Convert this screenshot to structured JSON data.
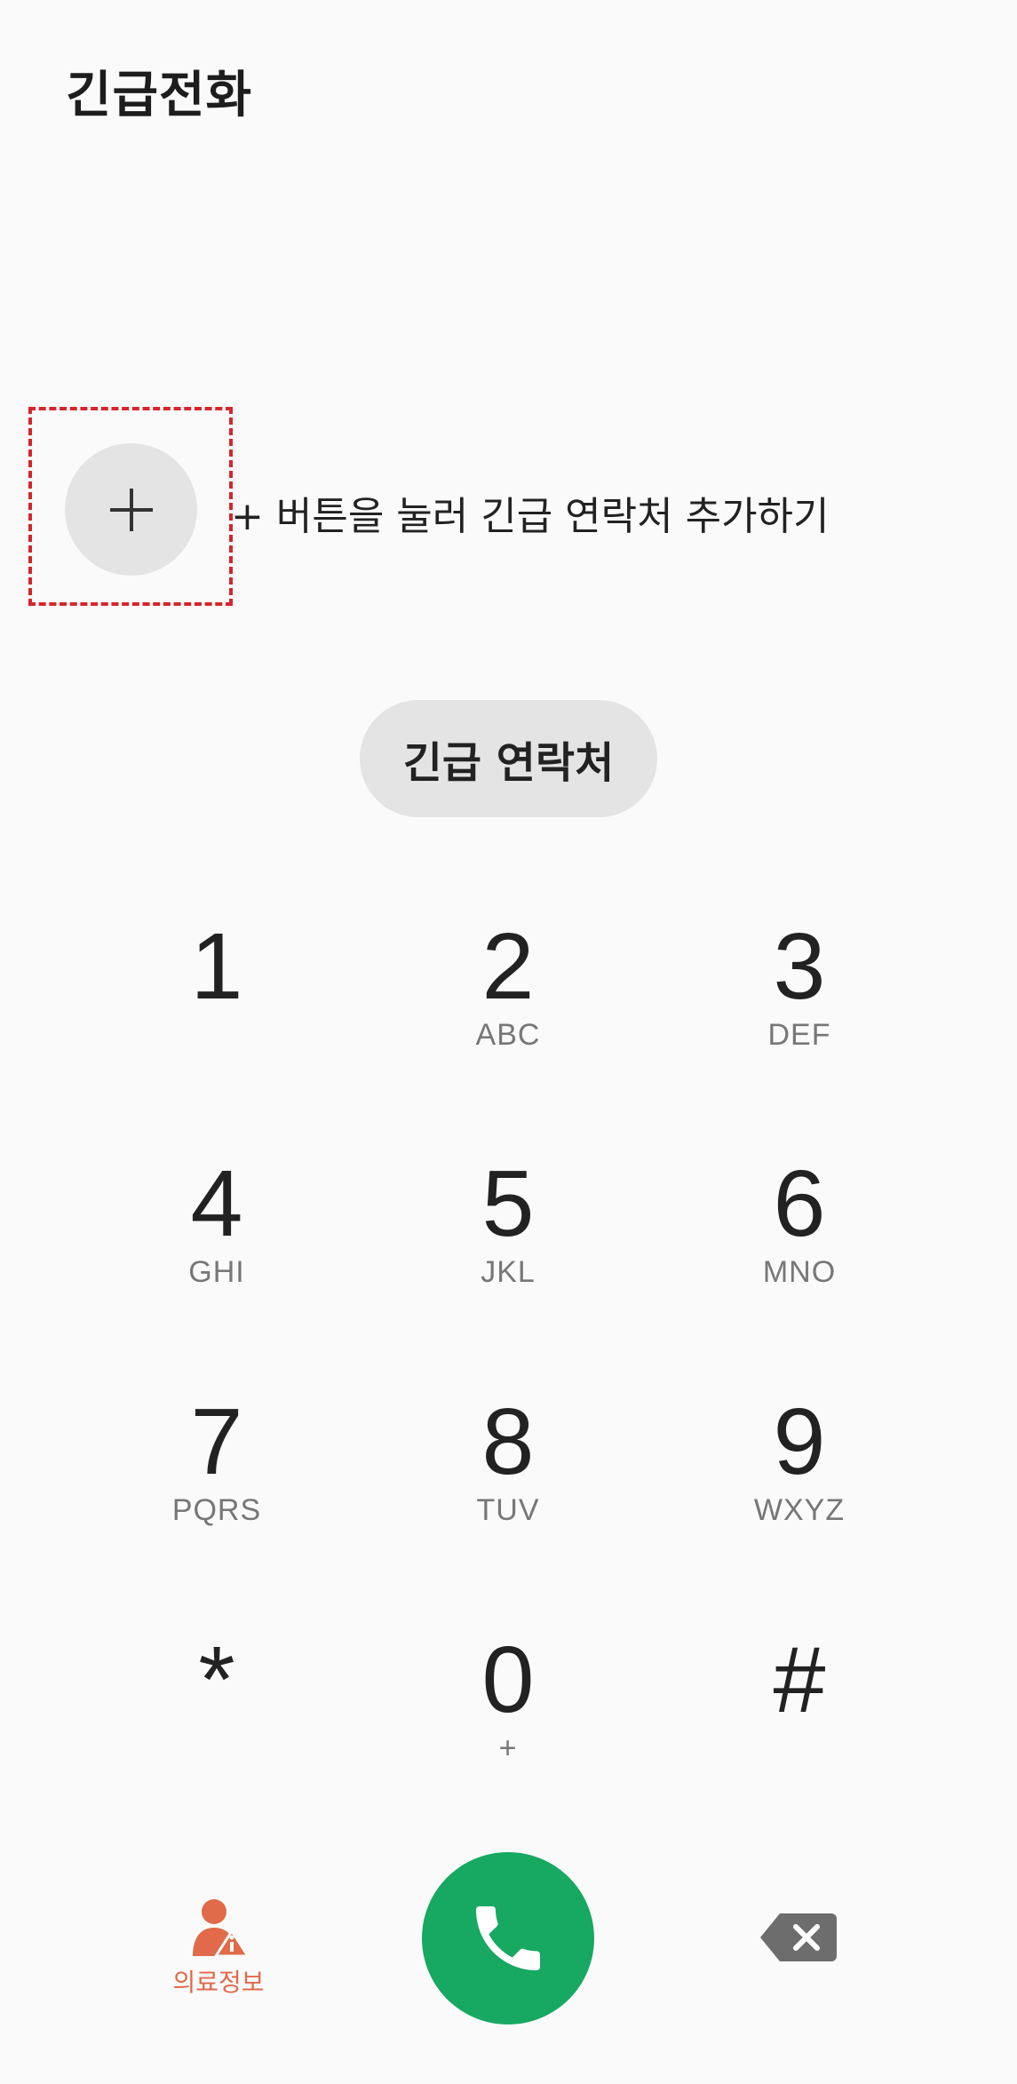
{
  "header": {
    "title": "긴급전화"
  },
  "add_contact": {
    "button_icon": "plus-icon",
    "hint": "+ 버튼을 눌러 긴급 연락처 추가하기"
  },
  "contacts_button": {
    "label": "긴급 연락처"
  },
  "keypad": {
    "keys": [
      {
        "digit": "1",
        "letters": ""
      },
      {
        "digit": "2",
        "letters": "ABC"
      },
      {
        "digit": "3",
        "letters": "DEF"
      },
      {
        "digit": "4",
        "letters": "GHI"
      },
      {
        "digit": "5",
        "letters": "JKL"
      },
      {
        "digit": "6",
        "letters": "MNO"
      },
      {
        "digit": "7",
        "letters": "PQRS"
      },
      {
        "digit": "8",
        "letters": "TUV"
      },
      {
        "digit": "9",
        "letters": "WXYZ"
      },
      {
        "digit": "*",
        "letters": ""
      },
      {
        "digit": "0",
        "letters": "+"
      },
      {
        "digit": "#",
        "letters": ""
      }
    ]
  },
  "bottom_bar": {
    "medical_info": {
      "label": "의료정보",
      "icon": "medical-info-icon"
    },
    "call": {
      "icon": "phone-icon"
    },
    "backspace": {
      "icon": "backspace-icon"
    }
  },
  "colors": {
    "accent_green": "#17a862",
    "medical_orange": "#e06a4a",
    "highlight_red": "#d6262b",
    "pill_gray": "#e4e4e4"
  }
}
